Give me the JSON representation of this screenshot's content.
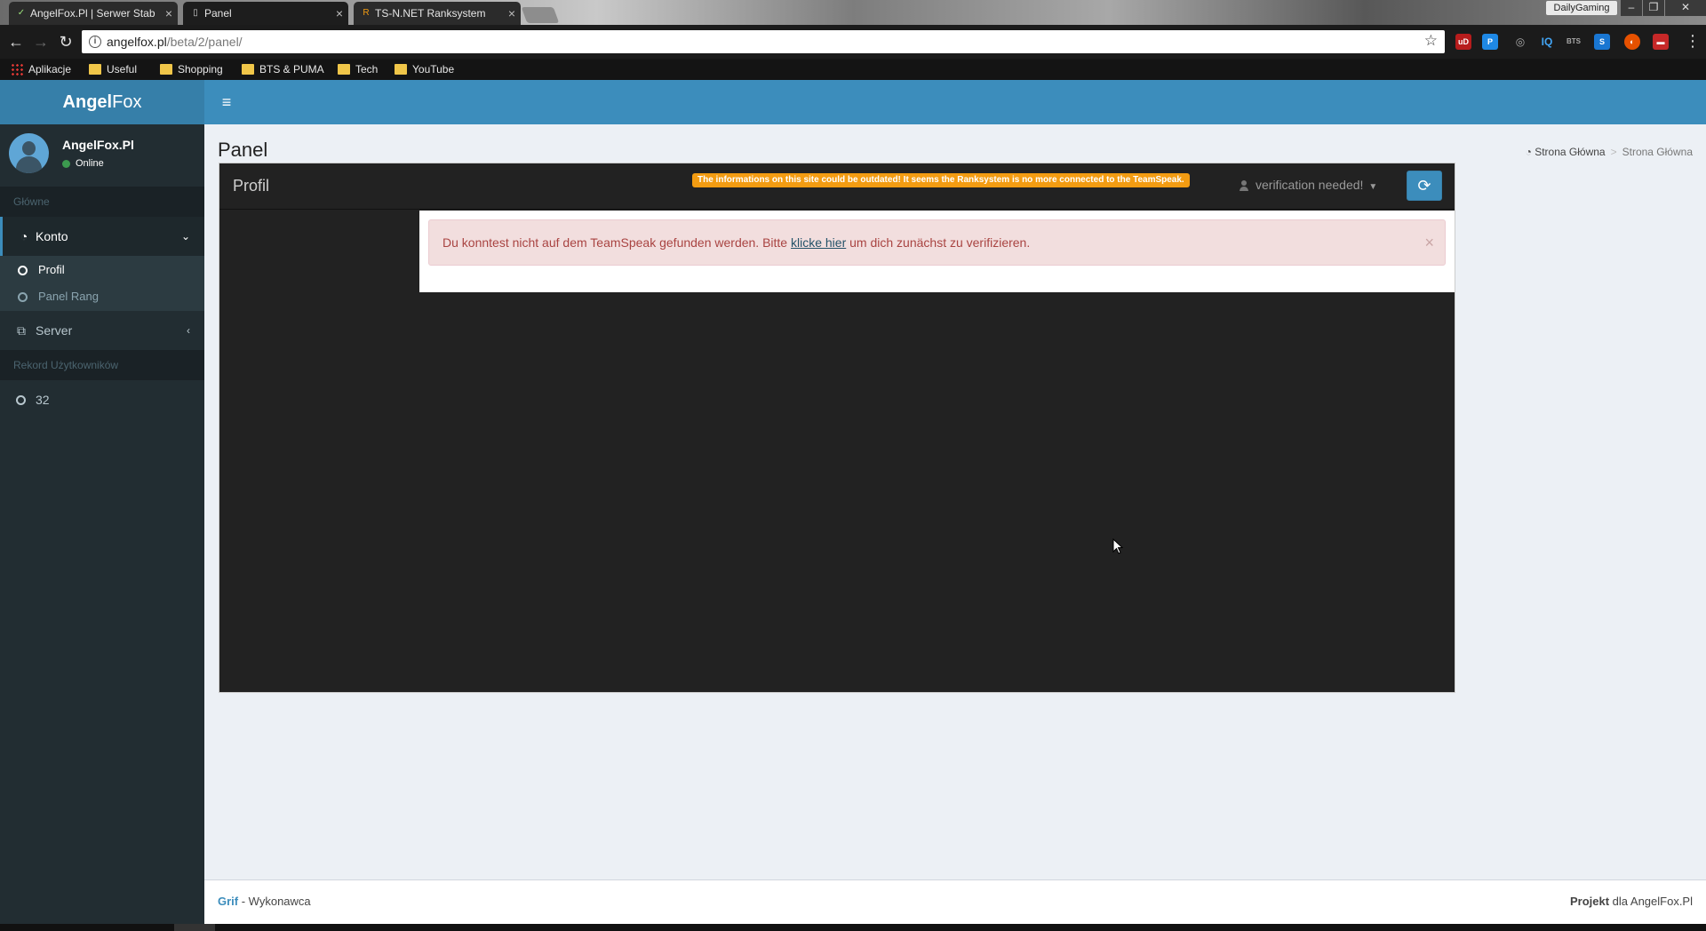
{
  "browser": {
    "tabs": [
      {
        "title": "AngelFox.Pl | Serwer Stab",
        "active": false
      },
      {
        "title": "Panel",
        "active": true
      },
      {
        "title": "TS-N.NET Ranksystem",
        "active": false
      }
    ],
    "profile_label": "DailyGaming",
    "url_host": "angelfox.pl",
    "url_path": "/beta/2/panel/",
    "bookmarks": [
      "Aplikacje",
      "Useful",
      "Shopping",
      "BTS & PUMA",
      "Tech",
      "YouTube"
    ]
  },
  "app": {
    "logo_bold": "Angel",
    "logo_rest": "Fox"
  },
  "sidebar": {
    "user_name": "AngelFox.Pl",
    "user_status": "Online",
    "header_main": "Główne",
    "konto_label": "Konto",
    "sub_items": [
      "Profil",
      "Panel Rang"
    ],
    "server_label": "Server",
    "header_record": "Rekord Użytkowników",
    "record_value": "32"
  },
  "content": {
    "page_title": "Panel",
    "breadcrumb": [
      "Strona Główna",
      "Strona Główna"
    ],
    "box_title": "Profil",
    "warning": "The informations on this site could be outdated! It seems the Ranksystem is no more connected to the TeamSpeak.",
    "verification": "verification needed!",
    "alert_before": "Du konntest nicht auf dem TeamSpeak gefunden werden. Bitte ",
    "alert_link": "klicke hier",
    "alert_after": " um dich zunächst zu verifizieren."
  },
  "footer": {
    "left_bold": "Grif",
    "left_rest": " - Wykonawca",
    "right_bold": "Projekt",
    "right_rest": " dla AngelFox.Pl"
  },
  "colors": {
    "brand_dark": "#367fa9",
    "brand": "#3c8dbc",
    "sidebar_bg": "#222d32",
    "warning": "#f39c12",
    "alert_bg": "#f2dede",
    "alert_text": "#a94442"
  }
}
